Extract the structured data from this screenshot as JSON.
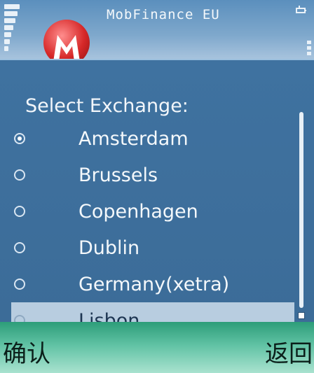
{
  "status": {
    "app_title": "MobFinance EU",
    "signal_icon": "signal-strength-icon",
    "battery_icon": "battery-icon"
  },
  "dialog": {
    "title": "Select Exchange:",
    "options": [
      {
        "label": "Amsterdam",
        "selected": true
      },
      {
        "label": "Brussels",
        "selected": false
      },
      {
        "label": "Copenhagen",
        "selected": false
      },
      {
        "label": "Dublin",
        "selected": false
      },
      {
        "label": "Germany(xetra)",
        "selected": false
      },
      {
        "label": "Lisbon",
        "selected": false,
        "highlighted": true
      }
    ]
  },
  "softkeys": {
    "left_label": "确认",
    "right_label": "返回"
  },
  "colors": {
    "background": "#3e6f9c",
    "highlight": "#b8cde0",
    "softkey_bar": "#60c2a4"
  }
}
